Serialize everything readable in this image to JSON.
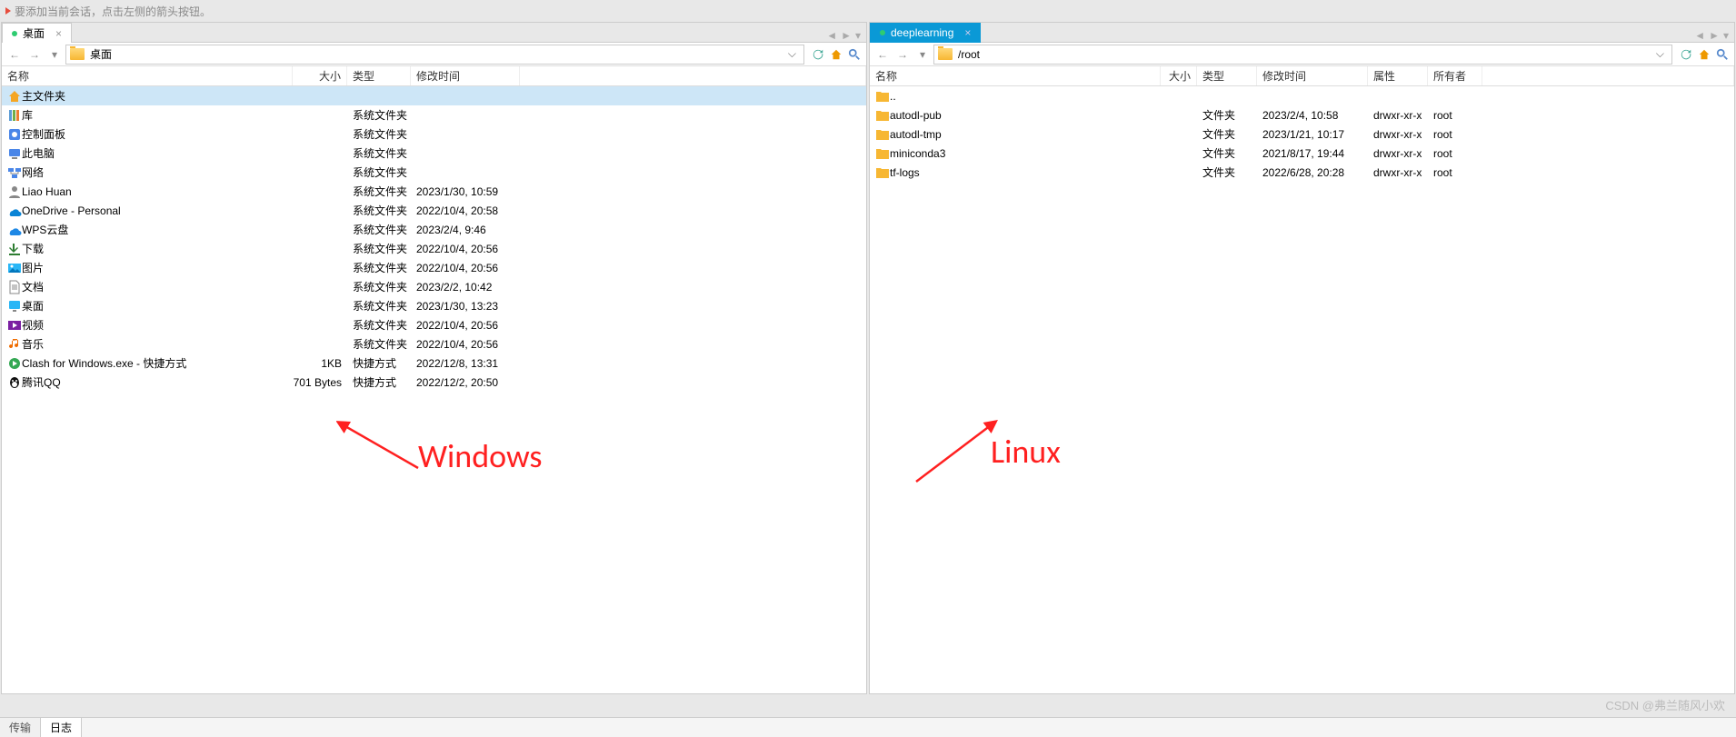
{
  "hint_text": "要添加当前会话，点击左侧的箭头按钮。",
  "left": {
    "tab_label": "桌面",
    "path_value": "桌面",
    "headers": {
      "name": "名称",
      "size": "大小",
      "type": "类型",
      "modified": "修改时间"
    },
    "rows": [
      {
        "icon": "home",
        "name": "主文件夹",
        "size": "",
        "type": "",
        "modified": "",
        "selected": true
      },
      {
        "icon": "library",
        "name": "库",
        "size": "",
        "type": "系统文件夹",
        "modified": ""
      },
      {
        "icon": "control",
        "name": "控制面板",
        "size": "",
        "type": "系统文件夹",
        "modified": ""
      },
      {
        "icon": "thispc",
        "name": "此电脑",
        "size": "",
        "type": "系统文件夹",
        "modified": ""
      },
      {
        "icon": "network",
        "name": "网络",
        "size": "",
        "type": "系统文件夹",
        "modified": ""
      },
      {
        "icon": "user",
        "name": "Liao Huan",
        "size": "",
        "type": "系统文件夹",
        "modified": "2023/1/30, 10:59"
      },
      {
        "icon": "onedrive",
        "name": "OneDrive - Personal",
        "size": "",
        "type": "系统文件夹",
        "modified": "2022/10/4, 20:58"
      },
      {
        "icon": "wps",
        "name": "WPS云盘",
        "size": "",
        "type": "系统文件夹",
        "modified": "2023/2/4, 9:46"
      },
      {
        "icon": "download",
        "name": "下载",
        "size": "",
        "type": "系统文件夹",
        "modified": "2022/10/4, 20:56"
      },
      {
        "icon": "pictures",
        "name": "图片",
        "size": "",
        "type": "系统文件夹",
        "modified": "2022/10/4, 20:56"
      },
      {
        "icon": "documents",
        "name": "文档",
        "size": "",
        "type": "系统文件夹",
        "modified": "2023/2/2, 10:42"
      },
      {
        "icon": "desktop",
        "name": "桌面",
        "size": "",
        "type": "系统文件夹",
        "modified": "2023/1/30, 13:23"
      },
      {
        "icon": "videos",
        "name": "视频",
        "size": "",
        "type": "系统文件夹",
        "modified": "2022/10/4, 20:56"
      },
      {
        "icon": "music",
        "name": "音乐",
        "size": "",
        "type": "系统文件夹",
        "modified": "2022/10/4, 20:56"
      },
      {
        "icon": "shortcut",
        "name": "Clash for Windows.exe - 快捷方式",
        "size": "1KB",
        "type": "快捷方式",
        "modified": "2022/12/8, 13:31"
      },
      {
        "icon": "qq",
        "name": "腾讯QQ",
        "size": "701 Bytes",
        "type": "快捷方式",
        "modified": "2022/12/2, 20:50"
      }
    ]
  },
  "right": {
    "tab_label": "deeplearning",
    "path_value": "/root",
    "headers": {
      "name": "名称",
      "size": "大小",
      "type": "类型",
      "modified": "修改时间",
      "attr": "属性",
      "owner": "所有者"
    },
    "rows": [
      {
        "icon": "folder-up",
        "name": "..",
        "size": "",
        "type": "",
        "modified": "",
        "attr": "",
        "owner": ""
      },
      {
        "icon": "folder",
        "name": "autodl-pub",
        "size": "",
        "type": "文件夹",
        "modified": "2023/2/4, 10:58",
        "attr": "drwxr-xr-x",
        "owner": "root"
      },
      {
        "icon": "folder",
        "name": "autodl-tmp",
        "size": "",
        "type": "文件夹",
        "modified": "2023/1/21, 10:17",
        "attr": "drwxr-xr-x",
        "owner": "root"
      },
      {
        "icon": "folder",
        "name": "miniconda3",
        "size": "",
        "type": "文件夹",
        "modified": "2021/8/17, 19:44",
        "attr": "drwxr-xr-x",
        "owner": "root"
      },
      {
        "icon": "folder",
        "name": "tf-logs",
        "size": "",
        "type": "文件夹",
        "modified": "2022/6/28, 20:28",
        "attr": "drwxr-xr-x",
        "owner": "root"
      }
    ]
  },
  "annotations": {
    "left_label": "Windows",
    "right_label": "Linux"
  },
  "bottom_tabs": {
    "transfer": "传输",
    "log": "日志"
  },
  "watermark": "CSDN @弗兰随风小欢"
}
